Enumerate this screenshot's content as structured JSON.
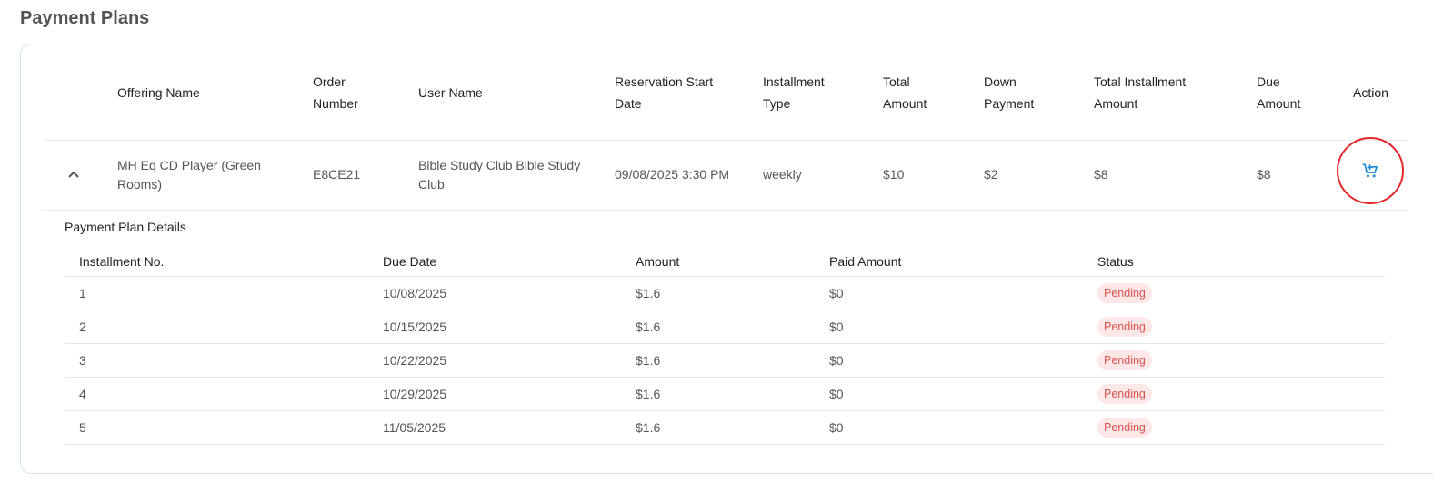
{
  "page": {
    "title": "Payment Plans"
  },
  "table": {
    "headers": {
      "offering_name": "Offering Name",
      "order_number_1": "Order",
      "order_number_2": "Number",
      "user_name": "User Name",
      "reservation_start_1": "Reservation Start",
      "reservation_start_2": "Date",
      "installment_type_1": "Installment",
      "installment_type_2": "Type",
      "total_amount_1": "Total",
      "total_amount_2": "Amount",
      "down_payment_1": "Down",
      "down_payment_2": "Payment",
      "total_installment_1": "Total Installment",
      "total_installment_2": "Amount",
      "due_amount_1": "Due",
      "due_amount_2": "Amount",
      "action": "Action"
    },
    "row": {
      "offering_name": "MH Eq CD Player (Green Rooms)",
      "order_number": "E8CE21",
      "user_name": "Bible Study Club Bible Study Club",
      "reservation_start": "09/08/2025 3:30 PM",
      "installment_type": "weekly",
      "total_amount": "$10",
      "down_payment": "$2",
      "total_installment_amount": "$8",
      "due_amount": "$8",
      "expand_icon": "chevron-up-icon",
      "action_icon": "add-to-cart-icon"
    }
  },
  "details": {
    "title": "Payment Plan Details",
    "headers": {
      "installment_no": "Installment No.",
      "due_date": "Due Date",
      "amount": "Amount",
      "paid_amount": "Paid Amount",
      "status": "Status"
    },
    "rows": [
      {
        "no": "1",
        "due_date": "10/08/2025",
        "amount": "$1.6",
        "paid": "$0",
        "status": "Pending"
      },
      {
        "no": "2",
        "due_date": "10/15/2025",
        "amount": "$1.6",
        "paid": "$0",
        "status": "Pending"
      },
      {
        "no": "3",
        "due_date": "10/22/2025",
        "amount": "$1.6",
        "paid": "$0",
        "status": "Pending"
      },
      {
        "no": "4",
        "due_date": "10/29/2025",
        "amount": "$1.6",
        "paid": "$0",
        "status": "Pending"
      },
      {
        "no": "5",
        "due_date": "11/05/2025",
        "amount": "$1.6",
        "paid": "$0",
        "status": "Pending"
      }
    ]
  },
  "colors": {
    "accent": "#1a8ad4",
    "highlight_ring": "#e3262a",
    "pending_bg": "#fde7e7",
    "pending_text": "#d9534f",
    "card_border": "#cfe6f0"
  }
}
